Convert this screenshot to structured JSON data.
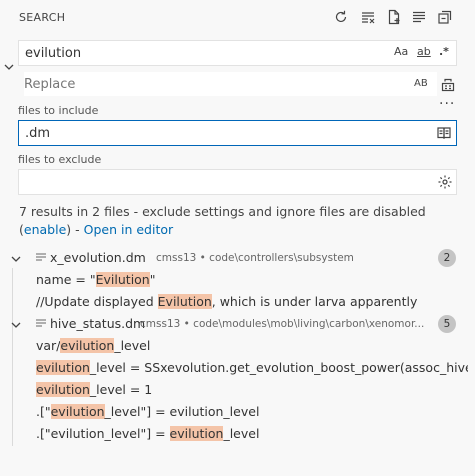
{
  "header": {
    "title": "SEARCH",
    "actions": [
      "refresh-icon",
      "clear-results-icon",
      "new-search-editor-icon",
      "view-as-tree-icon",
      "collapse-all-icon"
    ]
  },
  "search": {
    "value": "evilution",
    "options": {
      "match_case": "Aa",
      "whole_word": "ab",
      "regex": ".*"
    }
  },
  "replace": {
    "placeholder": "Replace",
    "preserve_case": "AB"
  },
  "include": {
    "label": "files to include",
    "value": ".dm"
  },
  "exclude": {
    "label": "files to exclude",
    "value": ""
  },
  "summary": {
    "text": "7 results in 2 files - exclude settings and ignore files are disabled",
    "open_paren": "(",
    "enable_link": "enable",
    "close_paren": ")",
    "separator": " - ",
    "open_editor_link": "Open in editor"
  },
  "results": [
    {
      "filename": "x_evolution.dm",
      "path": "cmss13 • code\\controllers\\subsystem",
      "count": "2",
      "matches": [
        {
          "before": "name = \"",
          "match": "Evilution",
          "after": "\""
        },
        {
          "before": "//Update displayed ",
          "match": "Evilution",
          "after": ", which is under larva apparently"
        }
      ]
    },
    {
      "filename": "hive_status.dm",
      "path": "cmss13 • code\\modules\\mob\\living\\carbon\\xenomor...",
      "count": "5",
      "matches": [
        {
          "before": "var/",
          "match": "evilution",
          "after": "_level"
        },
        {
          "before": "",
          "match": "evilution",
          "after": "_level = SSxevolution.get_evolution_boost_power(assoc_hive.hive..."
        },
        {
          "before": "",
          "match": "evilution",
          "after": "_level = 1"
        },
        {
          "before": ".[\"",
          "match": "evilution",
          "after": "_level\"] = evilution_level"
        },
        {
          "before": ".[\"evilution_level\"] = ",
          "match": "evilution",
          "after": "_level"
        }
      ]
    }
  ]
}
